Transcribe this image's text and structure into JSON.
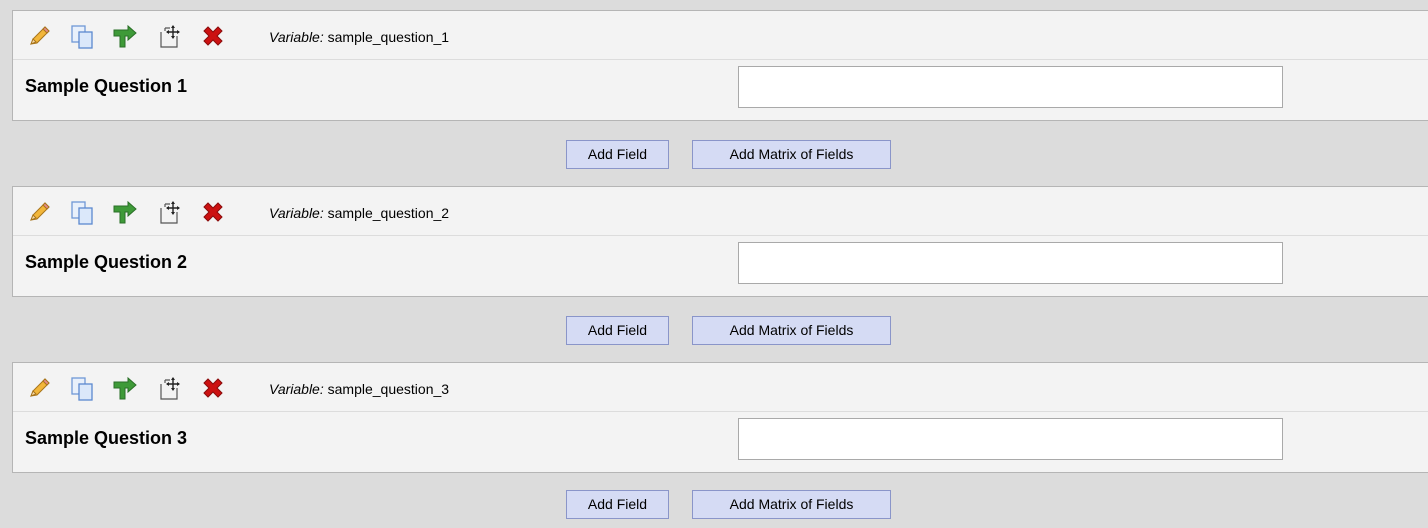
{
  "variable_prefix": "Variable:",
  "icons": {
    "edit": "pencil-icon",
    "copy": "copy-icon",
    "branching": "branching-arrow-icon",
    "move": "move-icon",
    "delete": "delete-x-icon"
  },
  "colors": {
    "page_background": "#dcdcdc",
    "block_background": "#f3f3f3",
    "button_background": "#d5dbf4",
    "button_border": "#8a95c9",
    "delete_red": "#cc1111",
    "branch_green": "#3e9a38"
  },
  "fields": [
    {
      "variable": "sample_question_1",
      "label": "Sample Question 1",
      "value": "",
      "add_field_label": "Add Field",
      "add_matrix_label": "Add Matrix of Fields"
    },
    {
      "variable": "sample_question_2",
      "label": "Sample Question 2",
      "value": "",
      "add_field_label": "Add Field",
      "add_matrix_label": "Add Matrix of Fields"
    },
    {
      "variable": "sample_question_3",
      "label": "Sample Question 3",
      "value": "",
      "add_field_label": "Add Field",
      "add_matrix_label": "Add Matrix of Fields"
    }
  ]
}
